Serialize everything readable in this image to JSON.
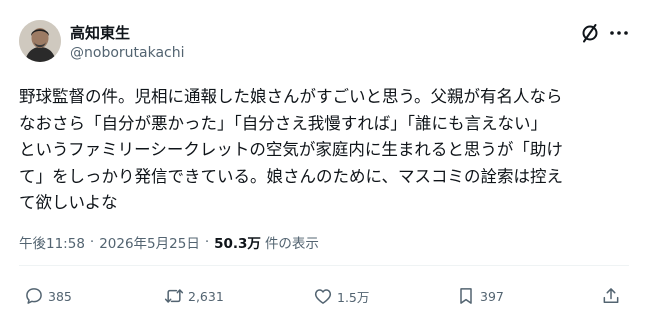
{
  "author": {
    "name": "高知東生",
    "handle": "@noborutakachi"
  },
  "post": {
    "lines": [
      "野球監督の件。児相に通報した娘さんがすごいと思う。父親が有名人なら",
      "なおさら「自分が悪かった」「自分さえ我慢すれば」「誰にも言えない」",
      "というファミリーシークレットの空気が家庭内に生まれると思うが「助け",
      "て」をしっかり発信できている。娘さんのために、マスコミの詮索は控え",
      "て欲しいよな"
    ],
    "time": "午後11:58",
    "separator": "·",
    "date": "2026年5月25日",
    "views_count": "50.3万",
    "views_label": "件の表示"
  },
  "actions": {
    "replies": "385",
    "reposts": "2,631",
    "likes": "1.5万",
    "bookmarks": "397"
  },
  "icons": {
    "top_right": [
      "grok-icon",
      "more-icon"
    ],
    "actions": [
      "reply-icon",
      "repost-icon",
      "like-icon",
      "bookmark-icon",
      "share-icon"
    ]
  },
  "colors": {
    "text": "#0f1419",
    "secondary": "#536471",
    "divider": "#eff3f4"
  }
}
